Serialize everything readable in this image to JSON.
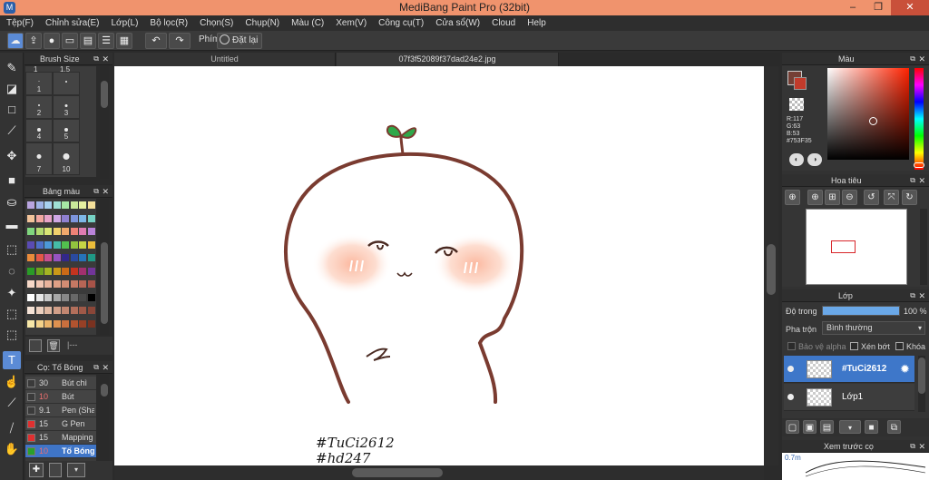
{
  "app": {
    "title": "MediBang Paint Pro (32bit)",
    "logo_letter": "M",
    "window_controls": {
      "minimize": "–",
      "maximize": "❐",
      "close": "✕"
    }
  },
  "menu": [
    "Tệp(F)",
    "Chỉnh sửa(E)",
    "Lớp(L)",
    "Bộ lọc(R)",
    "Chọn(S)",
    "Chụp(N)",
    "Màu (C)",
    "Xem(V)",
    "Công cụ(T)",
    "Cửa sổ(W)",
    "Cloud",
    "Help"
  ],
  "toolbar": {
    "key_label": "Phím",
    "reset_label": "Đặt lại",
    "icons": [
      "cloud-icon",
      "share-icon",
      "comment-icon",
      "note-icon",
      "document-icon",
      "list-icon",
      "grid-icon",
      "undo-icon",
      "redo-icon"
    ]
  },
  "left_tools": [
    "brush-icon",
    "eraser-icon",
    "rectangle-icon",
    "pen-icon",
    "move-icon",
    "fill-rect-icon",
    "bucket-icon",
    "gradient-icon",
    "select-rect-icon",
    "lasso-icon",
    "magic-wand-icon",
    "select-pen-icon",
    "select-eraser-icon",
    "text-icon",
    "operation-icon",
    "eyedropper-icon",
    "divide-icon",
    "hand-icon"
  ],
  "brush_size": {
    "title": "Brush Size",
    "header_numbers": [
      "1",
      "1.5"
    ],
    "cells": [
      "1",
      "2",
      "3",
      "4",
      "5",
      "7",
      "10"
    ]
  },
  "palette": {
    "title": "Bảng màu",
    "colors": [
      "#b9a5e0",
      "#9fb4e8",
      "#a7d1f0",
      "#9fe0d5",
      "#a6e6a4",
      "#c9e89a",
      "#e5f0a0",
      "#f4e09a",
      "#f2c39a",
      "#f2a7a0",
      "#e8a3c8",
      "#cfa7e5",
      "#8f80d0",
      "#7d95dc",
      "#7db7e6",
      "#76d2c4",
      "#80d67e",
      "#b2da70",
      "#d9e675",
      "#f1d16c",
      "#f0a96c",
      "#ee8377",
      "#de7cb2",
      "#b983d9",
      "#5a4bb3",
      "#4e6fc8",
      "#4c98d8",
      "#45bca7",
      "#52c04e",
      "#92c53e",
      "#c5d645",
      "#ebbc3a",
      "#ea8b3b",
      "#e55748",
      "#c84f91",
      "#9653c2",
      "#32288a",
      "#2a4aa0",
      "#2673b8",
      "#1f9885",
      "#2a9b27",
      "#6ea21d",
      "#a4b423",
      "#cc9918",
      "#cc6a17",
      "#c4341f",
      "#a3306e",
      "#72359a",
      "#f6d8c8",
      "#f1c7b4",
      "#e9b39c",
      "#dfa086",
      "#d38c73",
      "#c57863",
      "#b76555",
      "#a85348",
      "#ffffff",
      "#e6e6e6",
      "#c8c8c8",
      "#a8a8a8",
      "#888888",
      "#686868",
      "#484848",
      "#000000",
      "#f5e3d6",
      "#ecd0bf",
      "#e0b9a3",
      "#d2a089",
      "#c38771",
      "#b26f5b",
      "#9f5948",
      "#8a4638",
      "#f7e7a8",
      "#f3d28a",
      "#eab46a",
      "#dd9150",
      "#c96f3e",
      "#b1532f",
      "#964026",
      "#7a3220"
    ]
  },
  "brush_panel": {
    "title": "Cọ: Tố Bóng",
    "brushes": [
      {
        "size": "30",
        "name": "Bút chì",
        "color": "#3a3a3a"
      },
      {
        "size": "10",
        "name": "Bút",
        "color": "#3a3a3a"
      },
      {
        "size": "9.1",
        "name": "Pen (Sha",
        "color": "#3a3a3a"
      },
      {
        "size": "15",
        "name": "G Pen",
        "color": "#e03030"
      },
      {
        "size": "15",
        "name": "Mapping P",
        "color": "#e03030"
      },
      {
        "size": "10",
        "name": "Tố Bóng",
        "color": "#2aa02a"
      }
    ]
  },
  "tabs": [
    {
      "label": "Untitled"
    },
    {
      "label": "07f3f52089f37dad24e2.jpg"
    }
  ],
  "canvas": {
    "text_line1": "#TuCi2612",
    "text_line2": "#hd247"
  },
  "color_panel": {
    "title": "Màu",
    "r": "R:117",
    "g": "G:63",
    "b": "B:53",
    "hex": "#753F35",
    "primary_color": "#753f35",
    "secondary_color": "#ffffff"
  },
  "navigator": {
    "title": "Hoa tiêu"
  },
  "layer_panel": {
    "title": "Lớp",
    "opacity_label": "Độ trong",
    "opacity_value": "100 %",
    "opacity_fraction": 1.0,
    "blend_label": "Pha trộn",
    "blend_value": "Bình thường",
    "protect_alpha": "Bảo vệ alpha",
    "clipping": "Xén bớt",
    "lock": "Khóa",
    "layers": [
      {
        "name": "#TuCi2612",
        "selected": true
      },
      {
        "name": "Lớp1",
        "selected": false
      }
    ]
  },
  "brush_preview": {
    "title": "Xem trước cọ",
    "size_label": "0.7m"
  }
}
